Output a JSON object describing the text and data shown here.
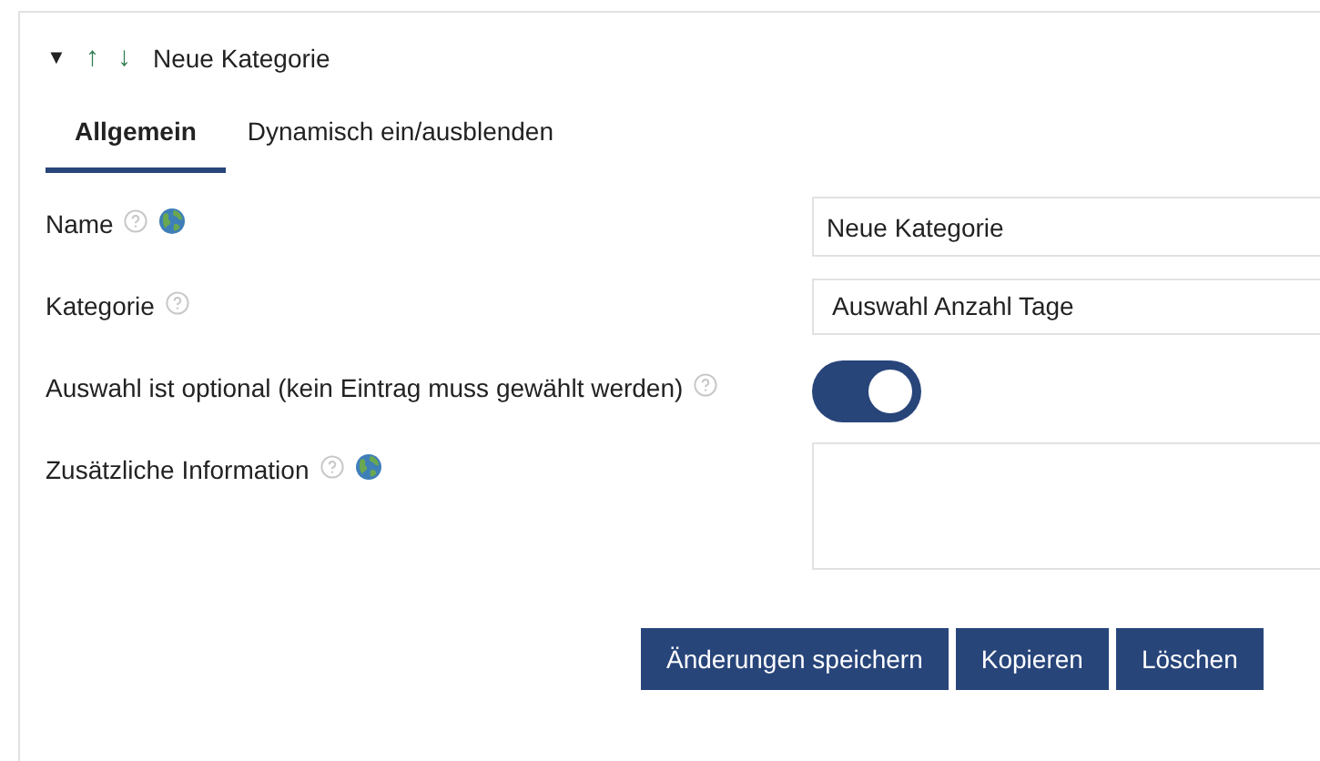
{
  "header": {
    "toggle": "▼",
    "up": "↑",
    "down": "↓",
    "title": "Neue Kategorie",
    "expanded": true
  },
  "tabs": [
    {
      "label": "Allgemein",
      "selected": true
    },
    {
      "label": "Dynamisch ein/ausblenden",
      "selected": false
    }
  ],
  "fields": [
    {
      "kind": "input",
      "label": "Name",
      "help": true,
      "translatable": true,
      "value": "Neue Kategorie"
    },
    {
      "kind": "select",
      "label": "Kategorie",
      "help": true,
      "translatable": false,
      "value": "Auswahl Anzahl Tage"
    },
    {
      "kind": "toggle",
      "label": "Auswahl ist optional (kein Eintrag muss gewählt werden)",
      "help": true,
      "translatable": false,
      "on": true
    },
    {
      "kind": "textarea",
      "label": "Zusätzliche Information",
      "help": true,
      "translatable": true
    }
  ],
  "buttons": [
    "Änderungen speichern",
    "Kopieren",
    "Löschen"
  ]
}
